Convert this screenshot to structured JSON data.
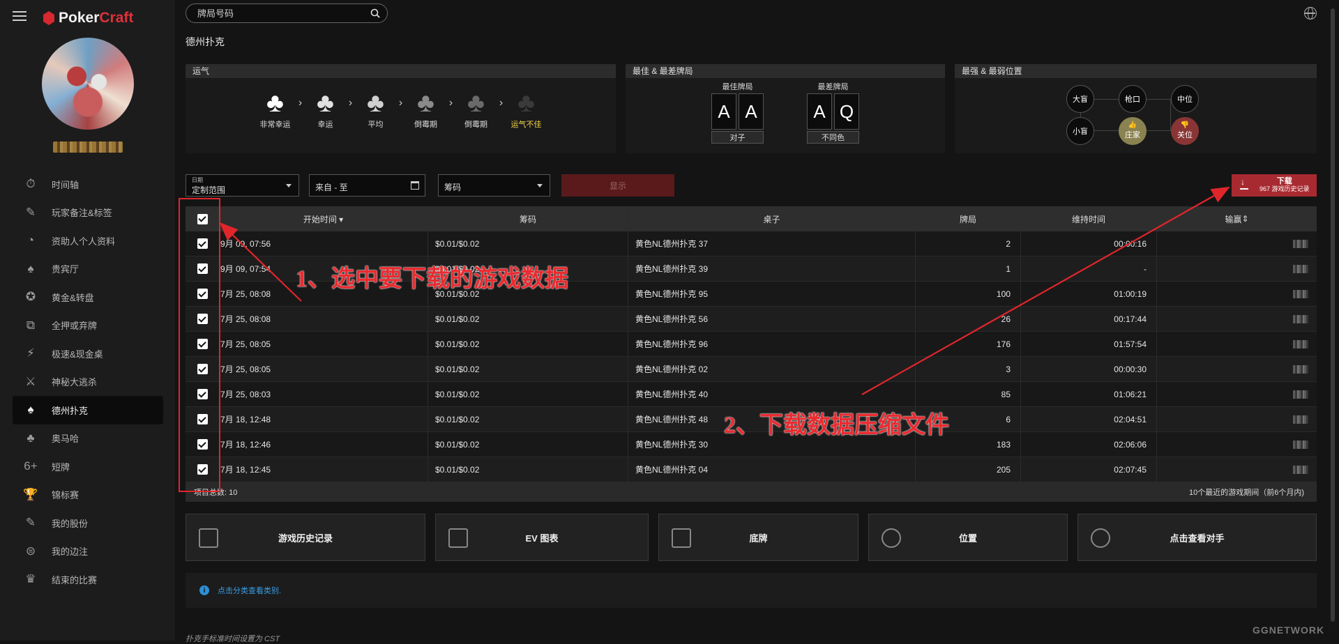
{
  "app": {
    "logo_part1": "Poker",
    "logo_part2": "Craft"
  },
  "search": {
    "placeholder": "牌局号码"
  },
  "page_title": "德州扑克",
  "sidebar": {
    "items": [
      {
        "label": "时间轴",
        "icon": "timeline-icon"
      },
      {
        "label": "玩家备注&标签",
        "icon": "player-notes-icon"
      },
      {
        "label": "资助人个人资料",
        "icon": "gauge-icon"
      },
      {
        "label": "贵宾厅",
        "icon": "vip-cards-icon"
      },
      {
        "label": "黄金&转盘",
        "icon": "spin-wheel-icon"
      },
      {
        "label": "全押或弃牌",
        "icon": "allin-fold-icon"
      },
      {
        "label": "极速&现金桌",
        "icon": "rush-cash-icon"
      },
      {
        "label": "神秘大逃杀",
        "icon": "mystery-battle-icon"
      },
      {
        "label": "德州扑克",
        "icon": "holdem-cards-icon",
        "active": true
      },
      {
        "label": "奥马哈",
        "icon": "omaha-cards-icon"
      },
      {
        "label": "短牌",
        "icon": "short-deck-icon"
      },
      {
        "label": "锦标赛",
        "icon": "trophy-icon"
      },
      {
        "label": "我的股份",
        "icon": "my-stake-icon"
      },
      {
        "label": "我的边注",
        "icon": "side-bet-icon"
      },
      {
        "label": "结束的比赛",
        "icon": "finished-tournament-icon"
      }
    ]
  },
  "panels": {
    "luck": {
      "title": "运气",
      "levels": [
        {
          "label": "非常幸运",
          "color": "#ffffff"
        },
        {
          "label": "幸运",
          "color": "#e0e0e0"
        },
        {
          "label": "平均",
          "color": "#d0d0d0"
        },
        {
          "label": "倒霉期",
          "color": "#8a8a8a"
        },
        {
          "label": "倒霉期",
          "color": "#6a6a6a"
        },
        {
          "label": "运气不佳",
          "color": "#3a3a3a",
          "highlight": "#f0d24a"
        }
      ]
    },
    "best_worst": {
      "title": "最佳 & 最差牌局",
      "best": {
        "title": "最佳牌局",
        "cards": [
          "A",
          "A"
        ],
        "sub": "对子"
      },
      "worst": {
        "title": "最差牌局",
        "cards": [
          "A",
          "Q"
        ],
        "sub": "不同色"
      }
    },
    "positions": {
      "title": "最强 & 最弱位置",
      "seats": {
        "bb": "大盲",
        "utg": "枪口",
        "mp": "中位",
        "sb": "小盲",
        "btn": "庄家",
        "co": "关位"
      },
      "good_color": "#8a8351",
      "bad_color": "#8a3535"
    }
  },
  "filters": {
    "date_label": "日期",
    "date_value": "定制范围",
    "range_placeholder": "来自 - 至",
    "stakes": "筹码",
    "show_button": "显示",
    "download_label": "下载",
    "download_sub": "967 游戏历史记录"
  },
  "table": {
    "headers": [
      "开始时间",
      "筹码",
      "桌子",
      "牌局",
      "维持时间",
      "输赢"
    ],
    "rows": [
      [
        "9月 09, 07:56",
        "$0.01/$0.02",
        "黄色NL德州扑克 37",
        "2",
        "00:00:16"
      ],
      [
        "9月 09, 07:54",
        "$0.01/$0.02",
        "黄色NL德州扑克 39",
        "1",
        "-"
      ],
      [
        "7月 25, 08:08",
        "$0.01/$0.02",
        "黄色NL德州扑克 95",
        "100",
        "01:00:19"
      ],
      [
        "7月 25, 08:08",
        "$0.01/$0.02",
        "黄色NL德州扑克 56",
        "26",
        "00:17:44"
      ],
      [
        "7月 25, 08:05",
        "$0.01/$0.02",
        "黄色NL德州扑克 96",
        "176",
        "01:57:54"
      ],
      [
        "7月 25, 08:05",
        "$0.01/$0.02",
        "黄色NL德州扑克 02",
        "3",
        "00:00:30"
      ],
      [
        "7月 25, 08:03",
        "$0.01/$0.02",
        "黄色NL德州扑克 40",
        "85",
        "01:06:21"
      ],
      [
        "7月 18, 12:48",
        "$0.01/$0.02",
        "黄色NL德州扑克 48",
        "6",
        "02:04:51"
      ],
      [
        "7月 18, 12:46",
        "$0.01/$0.02",
        "黄色NL德州扑克 30",
        "183",
        "02:06:06"
      ],
      [
        "7月 18, 12:45",
        "$0.01/$0.02",
        "黄色NL德州扑克 04",
        "205",
        "02:07:45"
      ]
    ],
    "footer_left": "项目总数: 10",
    "footer_right": "10个最近的游戏期间（前6个月内)"
  },
  "cards": [
    {
      "label": "游戏历史记录",
      "icon": "history-video-icon"
    },
    {
      "label": "EV 图表",
      "icon": "ev-chart-icon"
    },
    {
      "label": "底牌",
      "icon": "hole-cards-grid-icon"
    },
    {
      "label": "位置",
      "icon": "position-pin-icon"
    },
    {
      "label": "点击查看对手",
      "icon": "opponent-devil-icon"
    }
  ],
  "info": {
    "link": "点击分类查看类别."
  },
  "footer": {
    "timezone": "扑克手标准时间设置为 CST",
    "brand": "GGNETWORK"
  },
  "annotations": {
    "step1": "1、选中要下载的游戏数据",
    "step2": "2、下载数据压缩文件",
    "color": "#e0262b"
  }
}
